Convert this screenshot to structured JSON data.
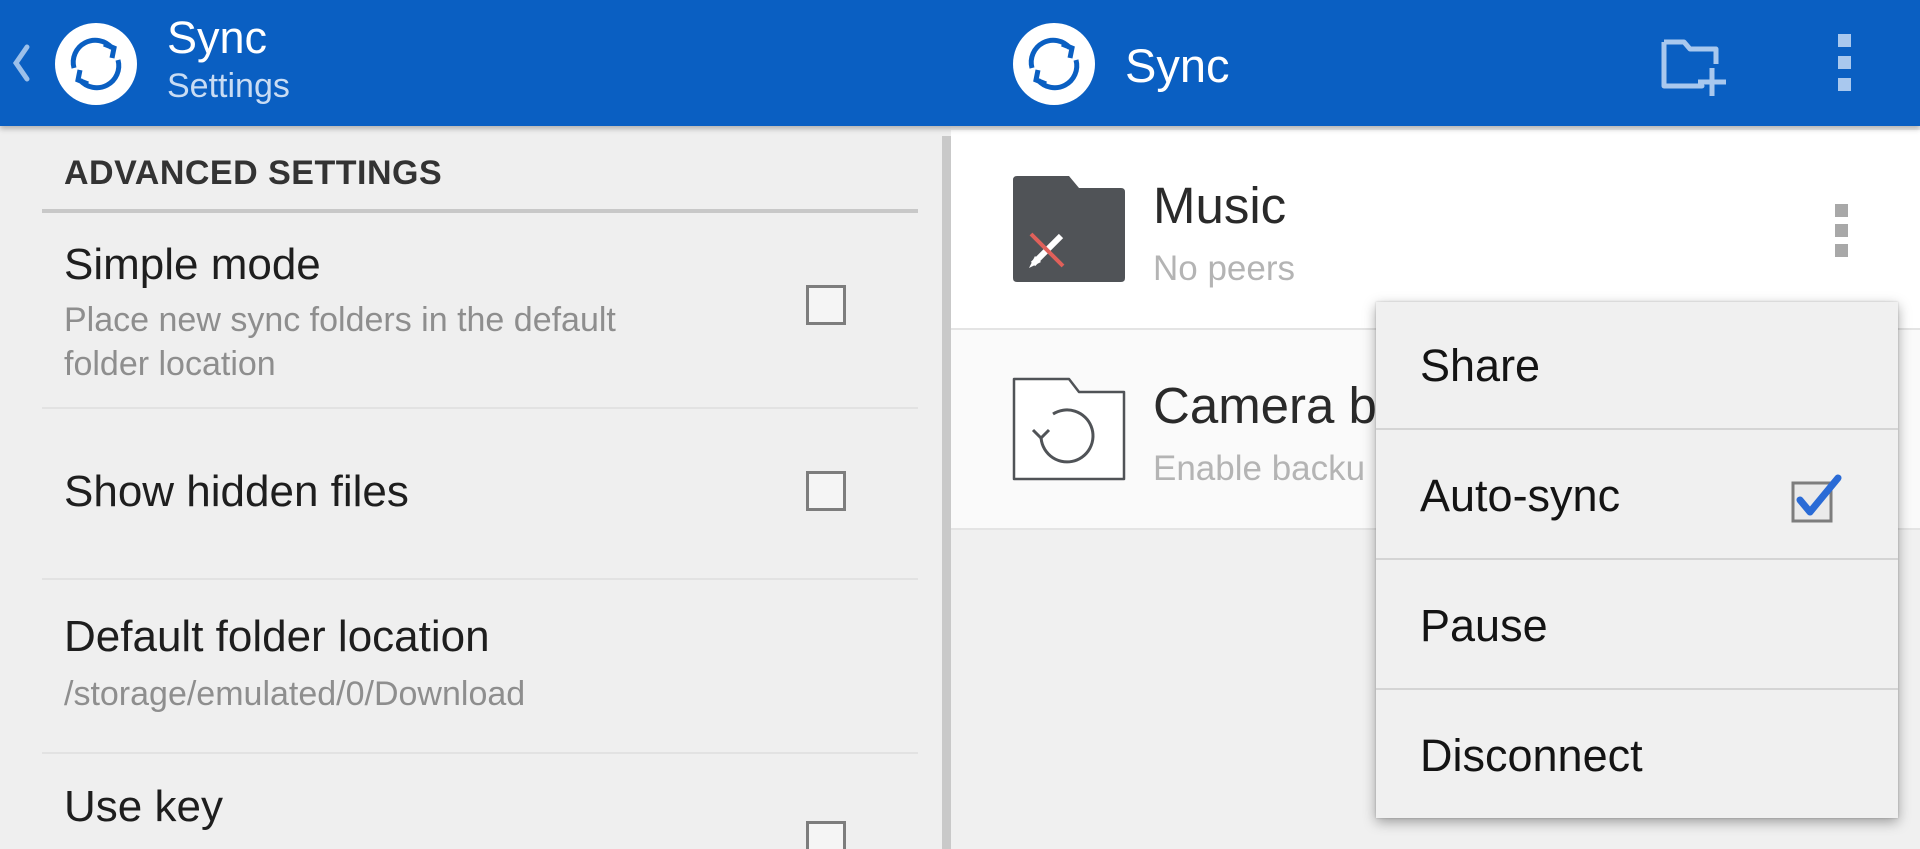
{
  "header": {
    "left_title": "Sync",
    "left_subtitle": "Settings",
    "right_title": "Sync",
    "icons": {
      "back": "chevron-left-icon",
      "logo": "sync-logo-icon",
      "add_folder": "add-folder-icon",
      "overflow": "more-vert-icon"
    },
    "bar_color": "#0a5fc2"
  },
  "settings": {
    "section_header": "ADVANCED SETTINGS",
    "items": [
      {
        "title": "Simple mode",
        "summary_lines": [
          "Place new sync folders in the default",
          "folder location"
        ],
        "checked": false
      },
      {
        "title": "Show hidden files",
        "checked": false
      },
      {
        "title": "Default folder location",
        "summary": "/storage/emulated/0/Download"
      },
      {
        "title": "Use key",
        "checked": false
      }
    ]
  },
  "folders": [
    {
      "name": "Music",
      "status": "No peers",
      "icon": "folder-readonly-icon"
    },
    {
      "name": "Camera b",
      "status": "Enable backu",
      "icon": "camera-backup-folder-icon"
    }
  ],
  "popup_menu": {
    "items": [
      {
        "label": "Share"
      },
      {
        "label": "Auto-sync",
        "checked": true
      },
      {
        "label": "Pause"
      },
      {
        "label": "Disconnect"
      }
    ],
    "check_color": "#2a6bd6"
  }
}
